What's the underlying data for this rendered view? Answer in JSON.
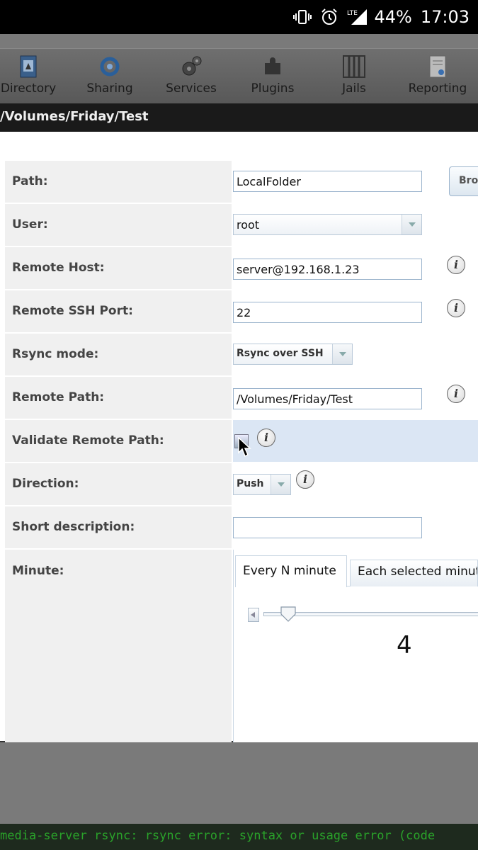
{
  "status_bar": {
    "battery": "44%",
    "time": "17:03",
    "network": "LTE"
  },
  "nav": {
    "items": [
      {
        "label": "Directory",
        "icon": "directory-icon"
      },
      {
        "label": "Sharing",
        "icon": "sharing-icon"
      },
      {
        "label": "Services",
        "icon": "services-icon"
      },
      {
        "label": "Plugins",
        "icon": "plugins-icon"
      },
      {
        "label": "Jails",
        "icon": "jails-icon"
      },
      {
        "label": "Reporting",
        "icon": "reporting-icon"
      }
    ]
  },
  "path_bar": "/Volumes/Friday/Test",
  "form": {
    "path": {
      "label": "Path:",
      "value": "LocalFolder",
      "browse": "Browse"
    },
    "user": {
      "label": "User:",
      "value": "root"
    },
    "remote_host": {
      "label": "Remote Host:",
      "value": "server@192.168.1.23"
    },
    "remote_ssh_port": {
      "label": "Remote SSH Port:",
      "value": "22"
    },
    "rsync_mode": {
      "label": "Rsync mode:",
      "value": "Rsync over SSH"
    },
    "remote_path": {
      "label": "Remote Path:",
      "value": "/Volumes/Friday/Test"
    },
    "validate_remote_path": {
      "label": "Validate Remote Path:",
      "checked": true
    },
    "direction": {
      "label": "Direction:",
      "value": "Push"
    },
    "short_description": {
      "label": "Short description:",
      "value": ""
    },
    "minute": {
      "label": "Minute:",
      "tabs": [
        "Every N minute",
        "Each selected minute"
      ],
      "slider_value": "4"
    }
  },
  "terminal_text": "media-server rsync: rsync error: syntax or usage error (code"
}
